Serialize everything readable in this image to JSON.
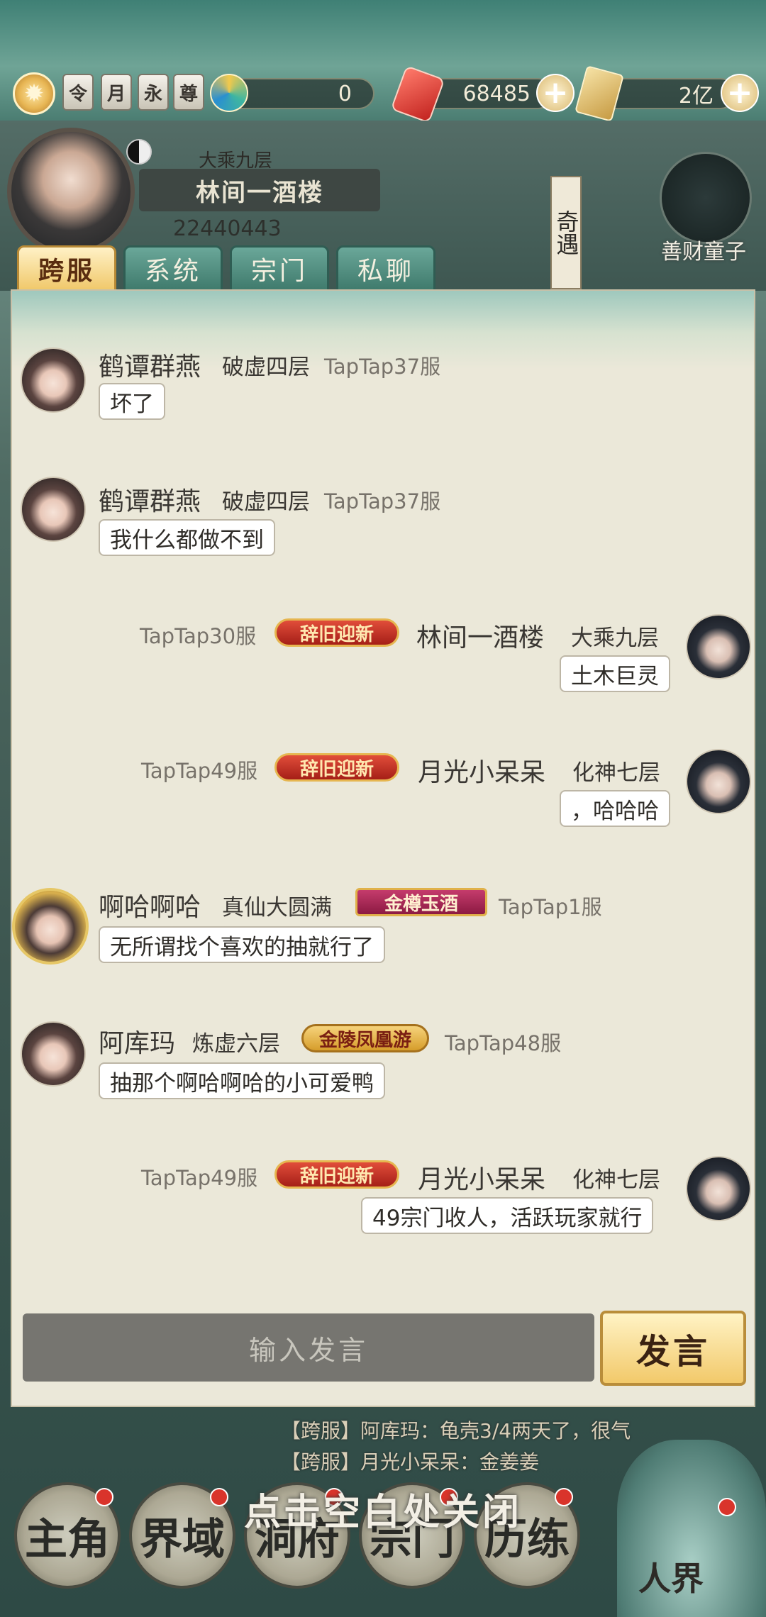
{
  "resources": {
    "badges": [
      "令",
      "月",
      "永",
      "尊"
    ],
    "spirit_value": "0",
    "gem_value": "68485",
    "scroll_value": "2亿"
  },
  "profile": {
    "realm": "大乘九层",
    "name": "林间一酒楼",
    "uid": "22440443",
    "qiyu": "奇遇",
    "shancai": "善财童子"
  },
  "tabs": [
    "跨服",
    "系统",
    "宗门",
    "私聊"
  ],
  "messages": [
    {
      "side": "left",
      "name": "鹤谭群燕",
      "realm": "破虚四层",
      "server": "TapTap37服",
      "text": "坏了"
    },
    {
      "side": "left",
      "name": "鹤谭群燕",
      "realm": "破虚四层",
      "server": "TapTap37服",
      "text": "我什么都做不到"
    },
    {
      "side": "right",
      "name": "林间一酒楼",
      "realm": "大乘九层",
      "server": "TapTap30服",
      "tag": "辞旧迎新",
      "text": "土木巨灵"
    },
    {
      "side": "right",
      "name": "月光小呆呆",
      "realm": "化神七层",
      "server": "TapTap49服",
      "tag": "辞旧迎新",
      "text": "，哈哈哈"
    },
    {
      "side": "left",
      "name": "啊哈啊哈",
      "realm": "真仙大圆满",
      "server": "TapTap1服",
      "tag": "金樽玉酒",
      "text": "无所谓找个喜欢的抽就行了"
    },
    {
      "side": "left",
      "name": "阿库玛",
      "realm": "炼虚六层",
      "server": "TapTap48服",
      "tag": "金陵凤凰游",
      "text": "抽那个啊哈啊哈的小可爱鸭"
    },
    {
      "side": "right",
      "name": "月光小呆呆",
      "realm": "化神七层",
      "server": "TapTap49服",
      "tag": "辞旧迎新",
      "text": "49宗门收人，活跃玩家就行"
    }
  ],
  "input": {
    "placeholder": "输入发言",
    "send": "发言"
  },
  "feed": [
    "【跨服】阿库玛：龟壳3/4两天了，很气",
    "【跨服】月光小呆呆：金姜姜"
  ],
  "close_hint": "点击空白处关闭",
  "nav": {
    "items": [
      "主角",
      "界域",
      "洞府",
      "宗门",
      "历练"
    ],
    "world": "人界"
  }
}
